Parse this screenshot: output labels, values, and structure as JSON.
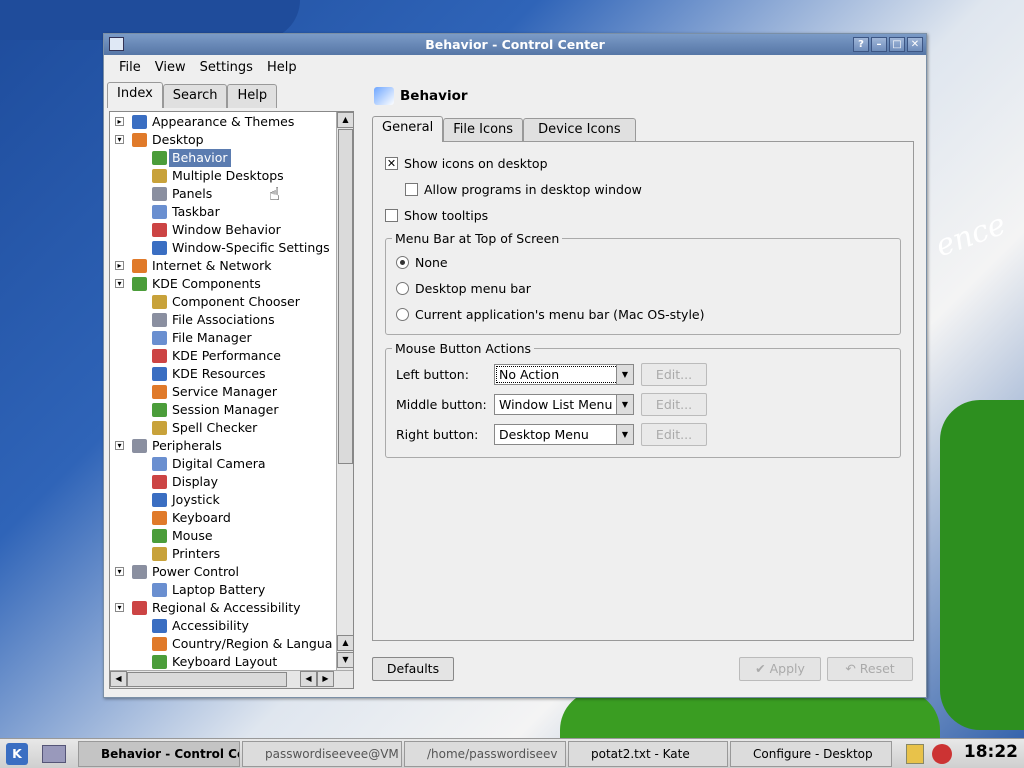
{
  "window": {
    "title": "Behavior - Control Center"
  },
  "menubar": [
    "File",
    "View",
    "Settings",
    "Help"
  ],
  "left_tabs": [
    "Index",
    "Search",
    "Help"
  ],
  "tree": [
    {
      "label": "Appearance & Themes",
      "level": 0,
      "expand": "+"
    },
    {
      "label": "Desktop",
      "level": 0,
      "expand": "-"
    },
    {
      "label": "Behavior",
      "level": 1,
      "selected": true
    },
    {
      "label": "Multiple Desktops",
      "level": 1
    },
    {
      "label": "Panels",
      "level": 1
    },
    {
      "label": "Taskbar",
      "level": 1
    },
    {
      "label": "Window Behavior",
      "level": 1
    },
    {
      "label": "Window-Specific Settings",
      "level": 1
    },
    {
      "label": "Internet & Network",
      "level": 0,
      "expand": "+"
    },
    {
      "label": "KDE Components",
      "level": 0,
      "expand": "-"
    },
    {
      "label": "Component Chooser",
      "level": 1
    },
    {
      "label": "File Associations",
      "level": 1
    },
    {
      "label": "File Manager",
      "level": 1
    },
    {
      "label": "KDE Performance",
      "level": 1
    },
    {
      "label": "KDE Resources",
      "level": 1
    },
    {
      "label": "Service Manager",
      "level": 1
    },
    {
      "label": "Session Manager",
      "level": 1
    },
    {
      "label": "Spell Checker",
      "level": 1
    },
    {
      "label": "Peripherals",
      "level": 0,
      "expand": "-"
    },
    {
      "label": "Digital Camera",
      "level": 1
    },
    {
      "label": "Display",
      "level": 1
    },
    {
      "label": "Joystick",
      "level": 1
    },
    {
      "label": "Keyboard",
      "level": 1
    },
    {
      "label": "Mouse",
      "level": 1
    },
    {
      "label": "Printers",
      "level": 1
    },
    {
      "label": "Power Control",
      "level": 0,
      "expand": "-"
    },
    {
      "label": "Laptop Battery",
      "level": 1
    },
    {
      "label": "Regional & Accessibility",
      "level": 0,
      "expand": "-"
    },
    {
      "label": "Accessibility",
      "level": 1
    },
    {
      "label": "Country/Region & Langua",
      "level": 1
    },
    {
      "label": "Keyboard Layout",
      "level": 1
    }
  ],
  "module": {
    "heading": "Behavior"
  },
  "right_tabs": [
    "General",
    "File Icons",
    "Device Icons"
  ],
  "general": {
    "show_icons": "Show icons on desktop",
    "allow_programs": "Allow programs in desktop window",
    "show_tooltips": "Show tooltips",
    "menubar_group": "Menu Bar at Top of Screen",
    "radio_none": "None",
    "radio_desktop": "Desktop menu bar",
    "radio_current": "Current application's menu bar (Mac OS-style)",
    "mouse_group": "Mouse Button Actions",
    "left_label": "Left button:",
    "left_value": "No Action",
    "middle_label": "Middle button:",
    "middle_value": "Window List Menu",
    "right_label": "Right button:",
    "right_value": "Desktop Menu",
    "edit": "Edit..."
  },
  "buttons": {
    "defaults": "Defaults",
    "apply": "Apply",
    "reset": "Reset"
  },
  "desktop": {
    "watermark": "ence"
  },
  "taskbar": {
    "tasks": [
      "Behavior - Control Ce",
      "passwordiseevee@VM",
      "/home/passwordiseev",
      "potat2.txt - Kate",
      "Configure - Desktop"
    ],
    "clock": "18:22"
  }
}
